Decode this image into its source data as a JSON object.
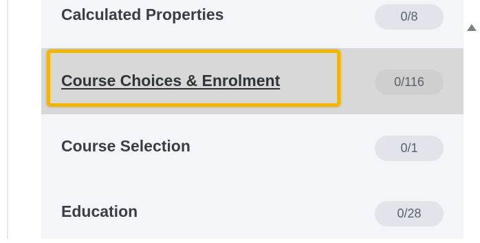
{
  "list": {
    "items": [
      {
        "label": "Calculated Properties",
        "count": "0/8",
        "selected": false
      },
      {
        "label": "Course Choices & Enrolment",
        "count": "0/116",
        "selected": true
      },
      {
        "label": "Course Selection",
        "count": "0/1",
        "selected": false
      },
      {
        "label": "Education",
        "count": "0/28",
        "selected": false
      }
    ]
  },
  "scrollbar": {
    "up_icon": "triangle-up-icon"
  },
  "colors": {
    "panel_background": "#f3f5f9",
    "selected_background": "#d8d8d8",
    "focus_outline": "#f2b600",
    "badge_background": "#e1e4ea",
    "label_text": "#393d44"
  }
}
